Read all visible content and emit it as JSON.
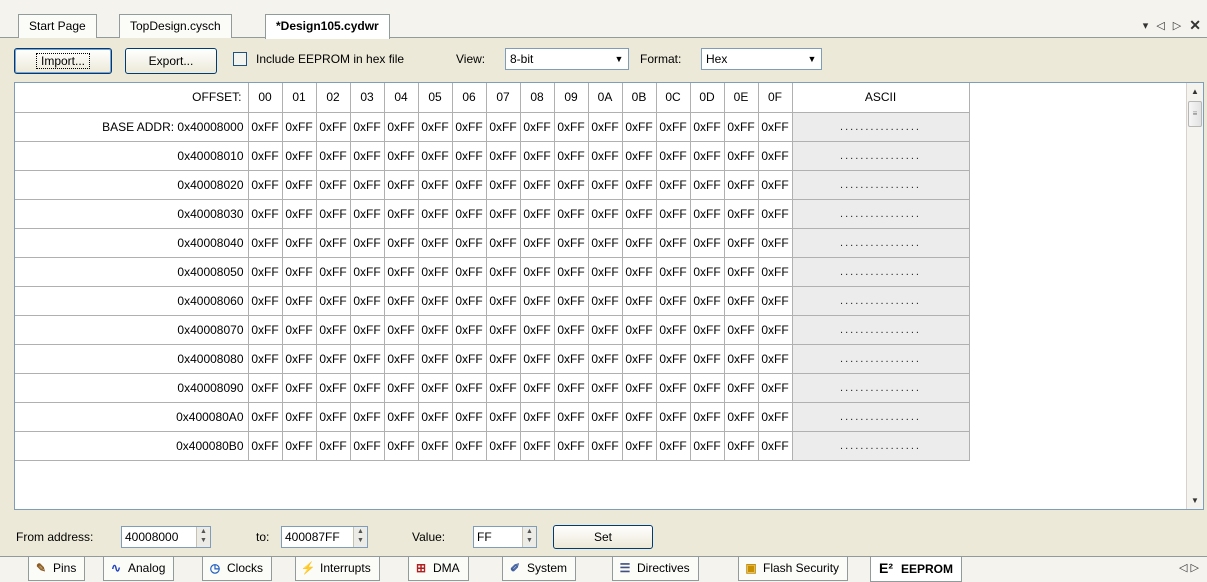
{
  "doc_tabs": [
    {
      "label": "Start Page"
    },
    {
      "label": "TopDesign.cysch"
    },
    {
      "label": "*Design105.cydwr"
    }
  ],
  "toolbar": {
    "import_label": "Import...",
    "export_label": "Export...",
    "include_eeprom_label": "Include EEPROM in hex file",
    "include_eeprom_checked": false,
    "view_label": "View:",
    "view_value": "8-bit",
    "format_label": "Format:",
    "format_value": "Hex"
  },
  "grid": {
    "offset_label": "OFFSET:",
    "columns": [
      "00",
      "01",
      "02",
      "03",
      "04",
      "05",
      "06",
      "07",
      "08",
      "09",
      "0A",
      "0B",
      "0C",
      "0D",
      "0E",
      "0F"
    ],
    "ascii_label": "ASCII",
    "rows": [
      {
        "addr": "BASE ADDR: 0x40008000",
        "values": [
          "0xFF",
          "0xFF",
          "0xFF",
          "0xFF",
          "0xFF",
          "0xFF",
          "0xFF",
          "0xFF",
          "0xFF",
          "0xFF",
          "0xFF",
          "0xFF",
          "0xFF",
          "0xFF",
          "0xFF",
          "0xFF"
        ],
        "ascii": "................"
      },
      {
        "addr": "0x40008010",
        "values": [
          "0xFF",
          "0xFF",
          "0xFF",
          "0xFF",
          "0xFF",
          "0xFF",
          "0xFF",
          "0xFF",
          "0xFF",
          "0xFF",
          "0xFF",
          "0xFF",
          "0xFF",
          "0xFF",
          "0xFF",
          "0xFF"
        ],
        "ascii": "................"
      },
      {
        "addr": "0x40008020",
        "values": [
          "0xFF",
          "0xFF",
          "0xFF",
          "0xFF",
          "0xFF",
          "0xFF",
          "0xFF",
          "0xFF",
          "0xFF",
          "0xFF",
          "0xFF",
          "0xFF",
          "0xFF",
          "0xFF",
          "0xFF",
          "0xFF"
        ],
        "ascii": "................"
      },
      {
        "addr": "0x40008030",
        "values": [
          "0xFF",
          "0xFF",
          "0xFF",
          "0xFF",
          "0xFF",
          "0xFF",
          "0xFF",
          "0xFF",
          "0xFF",
          "0xFF",
          "0xFF",
          "0xFF",
          "0xFF",
          "0xFF",
          "0xFF",
          "0xFF"
        ],
        "ascii": "................"
      },
      {
        "addr": "0x40008040",
        "values": [
          "0xFF",
          "0xFF",
          "0xFF",
          "0xFF",
          "0xFF",
          "0xFF",
          "0xFF",
          "0xFF",
          "0xFF",
          "0xFF",
          "0xFF",
          "0xFF",
          "0xFF",
          "0xFF",
          "0xFF",
          "0xFF"
        ],
        "ascii": "................"
      },
      {
        "addr": "0x40008050",
        "values": [
          "0xFF",
          "0xFF",
          "0xFF",
          "0xFF",
          "0xFF",
          "0xFF",
          "0xFF",
          "0xFF",
          "0xFF",
          "0xFF",
          "0xFF",
          "0xFF",
          "0xFF",
          "0xFF",
          "0xFF",
          "0xFF"
        ],
        "ascii": "................"
      },
      {
        "addr": "0x40008060",
        "values": [
          "0xFF",
          "0xFF",
          "0xFF",
          "0xFF",
          "0xFF",
          "0xFF",
          "0xFF",
          "0xFF",
          "0xFF",
          "0xFF",
          "0xFF",
          "0xFF",
          "0xFF",
          "0xFF",
          "0xFF",
          "0xFF"
        ],
        "ascii": "................"
      },
      {
        "addr": "0x40008070",
        "values": [
          "0xFF",
          "0xFF",
          "0xFF",
          "0xFF",
          "0xFF",
          "0xFF",
          "0xFF",
          "0xFF",
          "0xFF",
          "0xFF",
          "0xFF",
          "0xFF",
          "0xFF",
          "0xFF",
          "0xFF",
          "0xFF"
        ],
        "ascii": "................"
      },
      {
        "addr": "0x40008080",
        "values": [
          "0xFF",
          "0xFF",
          "0xFF",
          "0xFF",
          "0xFF",
          "0xFF",
          "0xFF",
          "0xFF",
          "0xFF",
          "0xFF",
          "0xFF",
          "0xFF",
          "0xFF",
          "0xFF",
          "0xFF",
          "0xFF"
        ],
        "ascii": "................"
      },
      {
        "addr": "0x40008090",
        "values": [
          "0xFF",
          "0xFF",
          "0xFF",
          "0xFF",
          "0xFF",
          "0xFF",
          "0xFF",
          "0xFF",
          "0xFF",
          "0xFF",
          "0xFF",
          "0xFF",
          "0xFF",
          "0xFF",
          "0xFF",
          "0xFF"
        ],
        "ascii": "................"
      },
      {
        "addr": "0x400080A0",
        "values": [
          "0xFF",
          "0xFF",
          "0xFF",
          "0xFF",
          "0xFF",
          "0xFF",
          "0xFF",
          "0xFF",
          "0xFF",
          "0xFF",
          "0xFF",
          "0xFF",
          "0xFF",
          "0xFF",
          "0xFF",
          "0xFF"
        ],
        "ascii": "................"
      },
      {
        "addr": "0x400080B0",
        "values": [
          "0xFF",
          "0xFF",
          "0xFF",
          "0xFF",
          "0xFF",
          "0xFF",
          "0xFF",
          "0xFF",
          "0xFF",
          "0xFF",
          "0xFF",
          "0xFF",
          "0xFF",
          "0xFF",
          "0xFF",
          "0xFF"
        ],
        "ascii": "................"
      }
    ]
  },
  "bottom": {
    "from_label": "From address:",
    "from_value": "40008000",
    "to_label": "to:",
    "to_value": "400087FF",
    "value_label": "Value:",
    "value_value": "FF",
    "set_label": "Set"
  },
  "bottom_tabs": [
    {
      "label": "Pins",
      "icon": "pins-icon"
    },
    {
      "label": "Analog",
      "icon": "analog-icon"
    },
    {
      "label": "Clocks",
      "icon": "clock-icon"
    },
    {
      "label": "Interrupts",
      "icon": "interrupts-icon"
    },
    {
      "label": "DMA",
      "icon": "dma-icon"
    },
    {
      "label": "System",
      "icon": "system-icon"
    },
    {
      "label": "Directives",
      "icon": "directives-icon"
    },
    {
      "label": "Flash Security",
      "icon": "flash-security-icon"
    },
    {
      "label": "EEPROM",
      "icon": "eeprom-icon"
    }
  ],
  "colors": {
    "window_bg": "#ece9d8",
    "grid_border": "#7f9db9",
    "ascii_bg": "#ececec",
    "analog_icon": "#2040c0",
    "clock_icon": "#1f5fbf"
  }
}
